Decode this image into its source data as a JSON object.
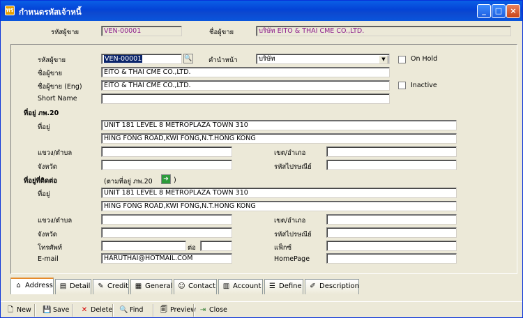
{
  "window": {
    "title": "กำหนดรหัสเจ้าหนี้",
    "app_icon": "ทร"
  },
  "header": {
    "vendor_code_label": "รหัสผู้ขาย",
    "vendor_code_value": "VEN-00001",
    "vendor_name_label": "ชื่อผู้ขาย",
    "vendor_name_value": "บริษัท EITO & THAI CME CO.,LTD."
  },
  "form": {
    "vendor_code_label": "รหัสผู้ขาย",
    "vendor_code_value": "VEN-00001",
    "prefix_label": "คำนำหน้า",
    "prefix_value": "บริษัท",
    "onhold_label": "On Hold",
    "vendor_name_label": "ชื่อผู้ขาย",
    "vendor_name_value": "EITO & THAI CME CO.,LTD.",
    "vendor_name_eng_label": "ชื่อผู้ขาย (Eng)",
    "vendor_name_eng_value": "EITO & THAI CME CO.,LTD.",
    "inactive_label": "Inactive",
    "short_name_label": "Short Name",
    "short_name_value": ""
  },
  "pp20": {
    "section_label": "ที่อยู่ ภพ.20",
    "address_label": "ที่อยู่",
    "address_line1": "UNIT 181 LEVEL 8 METROPLAZA TOWN 310",
    "address_line2": "HING FONG ROAD,KWI FONG,N.T.HONG KONG",
    "subdistrict_label": "แขวง/ตำบล",
    "district_label": "เขต/อำเภอ",
    "province_label": "จังหวัด",
    "postcode_label": "รหัสไปรษณีย์"
  },
  "contact_address": {
    "section_label": "ที่อยู่ที่ติดต่อ",
    "copy_hint": "(ตามที่อยู่ ภพ.20",
    "copy_hint_close": ")",
    "address_label": "ที่อยู่",
    "address_line1": "UNIT 181 LEVEL 8 METROPLAZA TOWN 310",
    "address_line2": "HING FONG ROAD,KWI FONG,N.T.HONG KONG",
    "subdistrict_label": "แขวง/ตำบล",
    "district_label": "เขต/อำเภอ",
    "province_label": "จังหวัด",
    "postcode_label": "รหัสไปรษณีย์",
    "phone_label": "โทรศัพท์",
    "ext_label": "ต่อ",
    "fax_label": "แฟ็กซ์",
    "email_label": "E-mail",
    "email_value": "HARUTHAI@HOTMAIL.COM",
    "homepage_label": "HomePage"
  },
  "tabs": [
    {
      "label": "Address",
      "icon": "home-icon"
    },
    {
      "label": "Detail",
      "icon": "detail-icon"
    },
    {
      "label": "Credit",
      "icon": "credit-icon"
    },
    {
      "label": "General",
      "icon": "general-icon"
    },
    {
      "label": "Contact",
      "icon": "contact-icon"
    },
    {
      "label": "Account",
      "icon": "account-icon"
    },
    {
      "label": "Define",
      "icon": "define-icon"
    },
    {
      "label": "Description",
      "icon": "description-icon"
    }
  ],
  "toolbar": {
    "new": "New",
    "save": "Save",
    "delete": "Delete",
    "find": "Find",
    "preview": "Preview",
    "close": "Close"
  }
}
